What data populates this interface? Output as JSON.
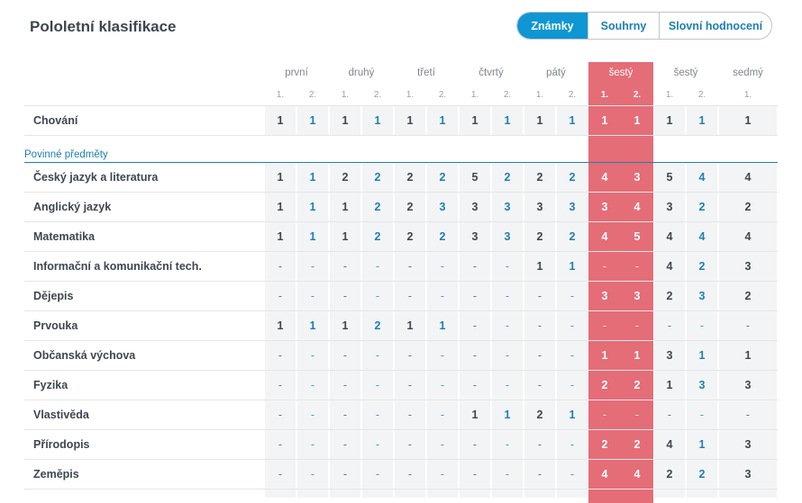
{
  "title": "Pololetní klasifikace",
  "view_tabs": [
    {
      "label": "Známky",
      "active": true
    },
    {
      "label": "Souhrny",
      "active": false
    },
    {
      "label": "Slovní hodnocení",
      "active": false
    }
  ],
  "years": [
    {
      "label": "první",
      "semesters": [
        "1.",
        "2."
      ]
    },
    {
      "label": "druhý",
      "semesters": [
        "1.",
        "2."
      ]
    },
    {
      "label": "třetí",
      "semesters": [
        "1.",
        "2."
      ]
    },
    {
      "label": "čtvrtý",
      "semesters": [
        "1.",
        "2."
      ]
    },
    {
      "label": "pátý",
      "semesters": [
        "1.",
        "2."
      ]
    },
    {
      "label": "šestý",
      "semesters": [
        "1.",
        "2."
      ],
      "highlighted": true
    },
    {
      "label": "šestý",
      "semesters": [
        "1.",
        "2."
      ]
    },
    {
      "label": "sedmý",
      "semesters": [
        "1."
      ]
    }
  ],
  "behavior_row": {
    "name": "Chování",
    "grades": [
      "1",
      "1",
      "1",
      "1",
      "1",
      "1",
      "1",
      "1",
      "1",
      "1",
      "1",
      "1",
      "1",
      "1",
      "1"
    ]
  },
  "section_label": "Povinné předměty",
  "subjects": [
    {
      "name": "Český jazyk a literatura",
      "grades": [
        "1",
        "1",
        "2",
        "2",
        "2",
        "2",
        "5",
        "2",
        "2",
        "2",
        "4",
        "3",
        "5",
        "4",
        "4"
      ]
    },
    {
      "name": "Anglický jazyk",
      "grades": [
        "1",
        "1",
        "1",
        "2",
        "2",
        "3",
        "3",
        "3",
        "3",
        "3",
        "3",
        "4",
        "3",
        "2",
        "2"
      ]
    },
    {
      "name": "Matematika",
      "grades": [
        "1",
        "1",
        "1",
        "2",
        "2",
        "2",
        "3",
        "3",
        "2",
        "2",
        "4",
        "5",
        "4",
        "4",
        "4"
      ]
    },
    {
      "name": "Informační a komunikační tech.",
      "grades": [
        "-",
        "-",
        "-",
        "-",
        "-",
        "-",
        "-",
        "-",
        "1",
        "1",
        "-",
        "-",
        "4",
        "2",
        "3"
      ]
    },
    {
      "name": "Dějepis",
      "grades": [
        "-",
        "-",
        "-",
        "-",
        "-",
        "-",
        "-",
        "-",
        "-",
        "-",
        "3",
        "3",
        "2",
        "3",
        "2"
      ]
    },
    {
      "name": "Prvouka",
      "grades": [
        "1",
        "1",
        "1",
        "2",
        "1",
        "1",
        "-",
        "-",
        "-",
        "-",
        "-",
        "-",
        "-",
        "-",
        "-"
      ]
    },
    {
      "name": "Občanská výchova",
      "grades": [
        "-",
        "-",
        "-",
        "-",
        "-",
        "-",
        "-",
        "-",
        "-",
        "-",
        "1",
        "1",
        "3",
        "1",
        "1"
      ]
    },
    {
      "name": "Fyzika",
      "grades": [
        "-",
        "-",
        "-",
        "-",
        "-",
        "-",
        "-",
        "-",
        "-",
        "-",
        "2",
        "2",
        "1",
        "3",
        "3"
      ]
    },
    {
      "name": "Vlastivěda",
      "grades": [
        "-",
        "-",
        "-",
        "-",
        "-",
        "-",
        "1",
        "1",
        "2",
        "1",
        "-",
        "-",
        "-",
        "-",
        "-"
      ]
    },
    {
      "name": "Přírodopis",
      "grades": [
        "-",
        "-",
        "-",
        "-",
        "-",
        "-",
        "-",
        "-",
        "-",
        "-",
        "2",
        "2",
        "4",
        "1",
        "3"
      ]
    },
    {
      "name": "Zeměpis",
      "grades": [
        "-",
        "-",
        "-",
        "-",
        "-",
        "-",
        "-",
        "-",
        "-",
        "-",
        "4",
        "4",
        "2",
        "2",
        "3"
      ]
    }
  ],
  "colors": {
    "accent": "#0f96d3",
    "link": "#1e7fb3",
    "highlight": "#e46d77",
    "column_bg": "#f3f4f5"
  }
}
